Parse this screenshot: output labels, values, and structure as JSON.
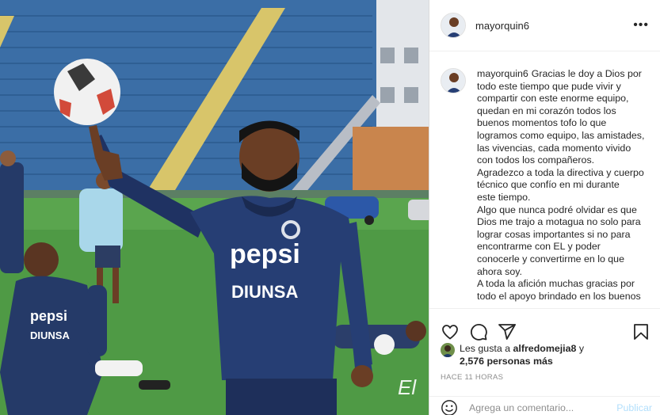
{
  "post": {
    "username": "mayorquin6",
    "more_icon": "more-horizontal-icon",
    "caption": {
      "username": "mayorquin6",
      "lines": [
        "Gracias le doy a Dios por",
        "todo este tiempo que pude vivir y",
        "compartir con este enorme equipo,",
        "quedan en mi corazón todos los",
        "buenos momentos tofo lo que",
        "logramos como equipo, las amistades,",
        "las vivencias, cada momento vivido",
        "con todos los compañeros.",
        "Agradezco a toda la directiva y cuerpo",
        "técnico que confío en mi durante",
        "este tiempo.",
        "Algo que nunca podré olvidar es que",
        "Dios me trajo a motagua no solo para",
        "lograr cosas importantes si no para",
        "encontrarme con EL y poder",
        "conocerle y convertirme en lo que",
        "ahora soy.",
        "A toda la afición muchas gracias por",
        "todo el apoyo brindado en los buenos"
      ]
    },
    "actions": {
      "like_icon": "heart-icon",
      "comment_icon": "comment-icon",
      "share_icon": "paper-plane-icon",
      "save_icon": "bookmark-icon"
    },
    "likes": {
      "prefix": "Les gusta a ",
      "user": "alfredomejia8",
      "middle": " y",
      "count": "2,576 personas más"
    },
    "timestamp": "HACE 11 HORAS",
    "comment": {
      "placeholder": "Agrega un comentario...",
      "publish_label": "Publicar",
      "emoji_icon": "smiley-icon"
    },
    "photo": {
      "jersey_sponsor": "pepsi",
      "jersey_sponsor_2": "DIUNSA",
      "watermark": "El"
    },
    "colors": {
      "publish_disabled": "#b2dffc",
      "muted_text": "#8e8e8e",
      "divider": "#efefef"
    }
  }
}
